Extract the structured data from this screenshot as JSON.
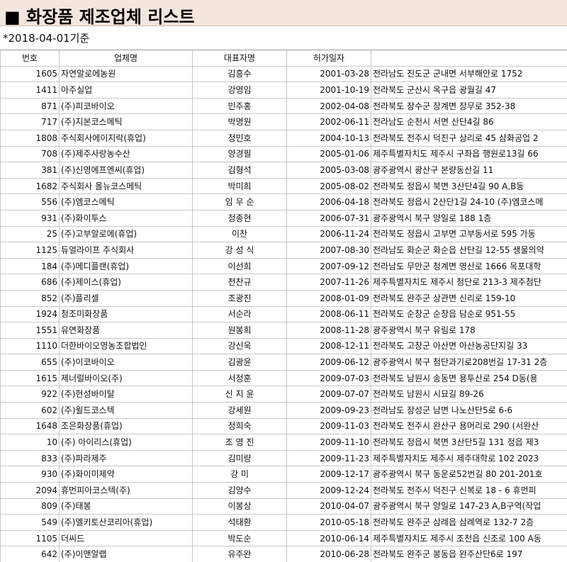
{
  "title": "■ 화장품 제조업체 리스트",
  "date_note": "*2018-04-01기준",
  "columns": [
    "번호",
    "업체명",
    "대표자명",
    "허가일자",
    ""
  ],
  "rows": [
    {
      "no": "1605",
      "name": "자연알로에농원",
      "rep": "김흥수",
      "date": "2001-03-28",
      "addr": "전라남도 진도군 군내면 서부해안로 1752"
    },
    {
      "no": "1411",
      "name": "아주실업",
      "rep": "강영임",
      "date": "2001-10-19",
      "addr": "전라북도 군산시 옥구읍 광월길 47"
    },
    {
      "no": "871",
      "name": "(주)피코바이오",
      "rep": "민주홍",
      "date": "2002-04-08",
      "addr": "전라북도 장수군 장계면 장무로 352-38"
    },
    {
      "no": "717",
      "name": "(주)지본코스메틱",
      "rep": "박명원",
      "date": "2002-06-11",
      "addr": "전라남도 순천시 서면 산단4길 86"
    },
    {
      "no": "1808",
      "name": "주식회사에이지락(휴업)",
      "rep": "정민호",
      "date": "2004-10-13",
      "addr": "전라북도 전주시 덕진구 상리로 45 삼화공업 2"
    },
    {
      "no": "708",
      "name": "(주)제주사랑농수산",
      "rep": "양경필",
      "date": "2005-01-06",
      "addr": "제주특별자치도 제주시 구좌읍 행원로13길 66"
    },
    {
      "no": "381",
      "name": "(주)신영에프엔씨(휴업)",
      "rep": "김형석",
      "date": "2005-03-08",
      "addr": "광주광역시 광산구 본량동산길 11"
    },
    {
      "no": "1682",
      "name": "주식회사 올뉴코스메틱",
      "rep": "박미희",
      "date": "2005-08-02",
      "addr": "전라북도 정읍시 북면 3산단4길 90 A,B동"
    },
    {
      "no": "556",
      "name": "(주)엠코스메틱",
      "rep": "임 우 순",
      "date": "2006-04-18",
      "addr": "전라북도 정읍시 2산단1길 24-10 (주)엠코스메"
    },
    {
      "no": "931",
      "name": "(주)화이투스",
      "rep": "정종현",
      "date": "2006-07-31",
      "addr": "광주광역시 북구 양일로 188 1층"
    },
    {
      "no": "25",
      "name": "(주)고부알로에(휴업)",
      "rep": "이찬",
      "date": "2006-11-24",
      "addr": "전라북도 정읍시 고부면 고부동서로 595 가동"
    },
    {
      "no": "1125",
      "name": "듀얼라이프 주식회사",
      "rep": "강 성 식",
      "date": "2007-08-30",
      "addr": "전라남도 화순군 화순읍 산단길 12-55 생물의약"
    },
    {
      "no": "184",
      "name": "(주)메디플랜(휴업)",
      "rep": "이선희",
      "date": "2007-09-12",
      "addr": "전라남도 무안군 청계면 영산로 1666 목포대학"
    },
    {
      "no": "686",
      "name": "(주)제이스(휴업)",
      "rep": "전찬규",
      "date": "2007-11-26",
      "addr": "제주특별자치도 제주시 첨단로 213-3 제주첨단"
    },
    {
      "no": "852",
      "name": "(주)플리셀",
      "rep": "조광진",
      "date": "2008-01-09",
      "addr": "전라북도 완주군 상관면 신리로 159-10"
    },
    {
      "no": "1924",
      "name": "청조미화장품",
      "rep": "서순라",
      "date": "2008-06-11",
      "addr": "전라북도 순창군 순창읍 담순로 951-55"
    },
    {
      "no": "1551",
      "name": "유연화장품",
      "rep": "원봉희",
      "date": "2008-11-28",
      "addr": "광주광역시 북구 유림로 178"
    },
    {
      "no": "1110",
      "name": "더한바이오영농조합법인",
      "rep": "강신욱",
      "date": "2008-12-11",
      "addr": "전라북도 고창군 아산면 아산농공단지길 33"
    },
    {
      "no": "655",
      "name": "(주)이코바이오",
      "rep": "김광윤",
      "date": "2009-06-12",
      "addr": "광주광역시 북구 첨단과기로208번길 17-31 2층"
    },
    {
      "no": "1615",
      "name": "제너럴바이오(주)",
      "rep": "서정훈",
      "date": "2009-07-03",
      "addr": "전라북도 남원시 송동면 용투산로 254  D동(용"
    },
    {
      "no": "922",
      "name": "(주)현성바이탈",
      "rep": "신 지 윤",
      "date": "2009-07-07",
      "addr": "전라북도 남원시 시묘길 89-26"
    },
    {
      "no": "602",
      "name": "(주)윌드코스텍",
      "rep": "강세원",
      "date": "2009-09-23",
      "addr": "전라남도 장성군 남면 나노산단5로 6-6"
    },
    {
      "no": "1648",
      "name": "조은화장품(휴업)",
      "rep": "정희숙",
      "date": "2009-11-03",
      "addr": "전라북도 전주시 완산구 용머리로 290 (서완산"
    },
    {
      "no": "10",
      "name": "(주) 아이리스(휴업)",
      "rep": "조 영 진",
      "date": "2009-11-10",
      "addr": "전라북도 정읍시 북면 3산단5길 131 정읍 제3"
    },
    {
      "no": "833",
      "name": "(주)파라제주",
      "rep": "김미량",
      "date": "2009-11-23",
      "addr": "제주특별자치도 제주시  제주대학로 102  2023"
    },
    {
      "no": "930",
      "name": "(주)화이미제약",
      "rep": "강 미",
      "date": "2009-12-17",
      "addr": "광주광역시 북구  동운로52번길 80  201-201호"
    },
    {
      "no": "2094",
      "name": "휴먼피아코스텍(주)",
      "rep": "김양수",
      "date": "2009-12-24",
      "addr": "전라북도 전주시 덕진구 신복로 18 - 6 휴먼피"
    },
    {
      "no": "809",
      "name": "(주)태봉",
      "rep": "이봉상",
      "date": "2010-04-07",
      "addr": "광주광역시 북구 양일로 147-23 A,B구역(작업"
    },
    {
      "no": "549",
      "name": "(주)엘키토산코리아(휴업)",
      "rep": "석태환",
      "date": "2010-05-18",
      "addr": "전라북도 완주군 삼례읍 삼례역로 132-7 2층"
    },
    {
      "no": "1105",
      "name": "더씨드",
      "rep": "박도순",
      "date": "2010-06-14",
      "addr": "제주특별자치도 제주시 조천읍 신조로 100 A동"
    },
    {
      "no": "642",
      "name": "(주)이앤알랩",
      "rep": "유주완",
      "date": "2010-06-28",
      "addr": "전라북도 완주군 봉동읍 완주산단6로 197"
    }
  ]
}
